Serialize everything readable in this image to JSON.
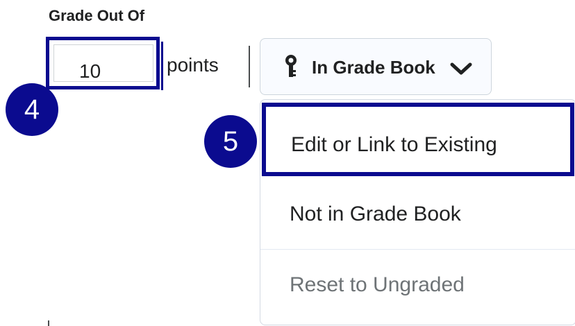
{
  "grade": {
    "label": "Grade Out Of",
    "value": "10",
    "units": "points"
  },
  "gradebook_button": {
    "label": "In Grade Book",
    "icon": "ribbon-icon",
    "dropdown_icon": "chevron-down-icon"
  },
  "badges": {
    "step4": "4",
    "step5": "5"
  },
  "menu": {
    "items": [
      {
        "label": "Edit or Link to Existing",
        "state": "highlighted"
      },
      {
        "label": "Not in Grade Book",
        "state": "normal"
      },
      {
        "label": "Reset to Ungraded",
        "state": "muted"
      }
    ]
  },
  "colors": {
    "highlight": "#0b0b8f",
    "text": "#202122",
    "muted_text": "#6e7376",
    "border": "#cdd5dc"
  }
}
